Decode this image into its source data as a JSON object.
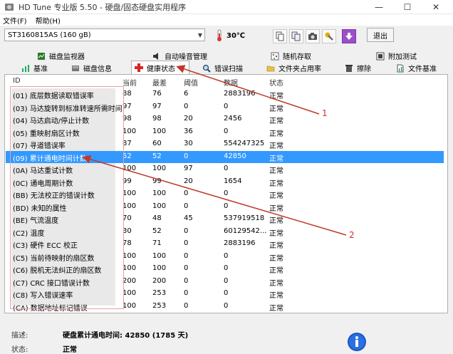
{
  "window": {
    "title": "HD Tune 专业版 5.50 - 硬盘/固态硬盘实用程序",
    "minimize": "—",
    "maximize": "☐",
    "close": "✕"
  },
  "menu": {
    "file": "文件(F)",
    "help": "帮助(H)"
  },
  "toolbar": {
    "drive": "ST3160815AS (160 gB)",
    "temperature": "30℃",
    "exit_label": "退出"
  },
  "tabs_row1": [
    {
      "label": "磁盘监视器",
      "icon": "monitor-icon"
    },
    {
      "label": "自动噪音管理",
      "icon": "speaker-icon"
    },
    {
      "label": "随机存取",
      "icon": "random-access-icon"
    },
    {
      "label": "附加测试",
      "icon": "extra-tests-icon"
    }
  ],
  "tabs_row2": [
    {
      "label": "基准",
      "icon": "benchmark-icon"
    },
    {
      "label": "磁盘信息",
      "icon": "disk-info-icon"
    },
    {
      "label": "健康状态",
      "icon": "health-icon",
      "active": true
    },
    {
      "label": "错误扫描",
      "icon": "magnifier-icon"
    },
    {
      "label": "文件夹占用率",
      "icon": "folder-icon"
    },
    {
      "label": "擦除",
      "icon": "trash-icon"
    },
    {
      "label": "文件基准",
      "icon": "file-benchmark-icon"
    }
  ],
  "table": {
    "headers": [
      "ID",
      "当前",
      "最差",
      "阈值",
      "数据",
      "状态"
    ],
    "rows": [
      [
        "(01) 底层数据读取错误率",
        "88",
        "76",
        "6",
        "2883196",
        "正常"
      ],
      [
        "(03) 马达旋转到标准转速所需时间",
        "97",
        "97",
        "0",
        "0",
        "正常"
      ],
      [
        "(04) 马达启动/停止计数",
        "98",
        "98",
        "20",
        "2456",
        "正常"
      ],
      [
        "(05) 重映射扇区计数",
        "100",
        "100",
        "36",
        "0",
        "正常"
      ],
      [
        "(07) 寻道错误率",
        "87",
        "60",
        "30",
        "554247325",
        "正常"
      ],
      [
        "(09) 累计通电时间计数",
        "52",
        "52",
        "0",
        "42850",
        "正常"
      ],
      [
        "(0A) 马达重试计数",
        "100",
        "100",
        "97",
        "0",
        "正常"
      ],
      [
        "(0C) 通电周期计数",
        "99",
        "99",
        "20",
        "1654",
        "正常"
      ],
      [
        "(BB) 无法校正的错误计数",
        "100",
        "100",
        "0",
        "0",
        "正常"
      ],
      [
        "(BD) 未知的属性",
        "100",
        "100",
        "0",
        "0",
        "正常"
      ],
      [
        "(BE) 气流温度",
        "70",
        "48",
        "45",
        "537919518",
        "正常"
      ],
      [
        "(C2) 温度",
        "30",
        "52",
        "0",
        "60129542...",
        "正常"
      ],
      [
        "(C3) 硬件 ECC 校正",
        "78",
        "71",
        "0",
        "2883196",
        "正常"
      ],
      [
        "(C5) 当前待映射的扇区数",
        "100",
        "100",
        "0",
        "0",
        "正常"
      ],
      [
        "(C6) 脱机无法纠正的扇区数",
        "100",
        "100",
        "0",
        "0",
        "正常"
      ],
      [
        "(C7) CRC 接口错误计数",
        "200",
        "200",
        "0",
        "0",
        "正常"
      ],
      [
        "(C8) 写入错误速率",
        "100",
        "253",
        "0",
        "0",
        "正常"
      ],
      [
        "(CA) 数据地址标记错误",
        "100",
        "253",
        "0",
        "0",
        "正常"
      ]
    ],
    "selected_index": 5
  },
  "status": {
    "desc_label": "描述:",
    "desc_value": "硬盘累计通电时间: 42850 (1785 天)",
    "state_label": "状态:",
    "state_value": "正常"
  },
  "annotations": {
    "label1": "1",
    "label2": "2"
  },
  "colors": {
    "selection": "#3399ff",
    "annotation": "#c0392b"
  }
}
